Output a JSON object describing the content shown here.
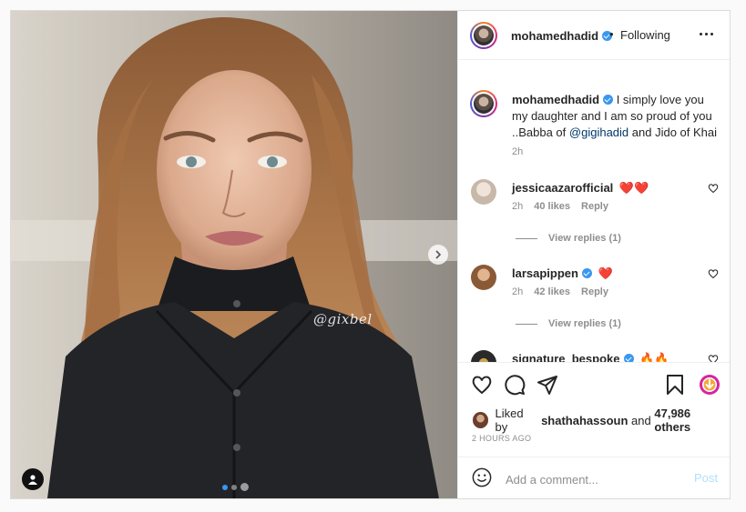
{
  "post": {
    "author": {
      "username": "mohamedhadid",
      "verified": true,
      "follow_separator": "•",
      "follow_status": "Following"
    },
    "media": {
      "watermark": "@gixbel",
      "carousel_dots": 3,
      "active_dot": 0
    },
    "caption": {
      "username": "mohamedhadid",
      "text_before": "I simply love you my daughter and I am so proud of you ..Babba of",
      "mention": "@gigihadid",
      "text_after": "and Jido of Khai",
      "time": "2h"
    },
    "comments": [
      {
        "username": "jessicaazarofficial",
        "text": "❤️❤️",
        "time": "2h",
        "likes": "40 likes",
        "reply_label": "Reply",
        "view_replies": "View replies (1)"
      },
      {
        "username": "larsapippen",
        "verified": true,
        "text": "❤️",
        "time": "2h",
        "likes": "42 likes",
        "reply_label": "Reply",
        "view_replies": "View replies (1)"
      },
      {
        "username": "signature_bespoke",
        "verified": true,
        "text": "🔥🔥"
      }
    ],
    "likes": {
      "prefix": "Liked by",
      "liker": "shathahassoun",
      "joiner": "and",
      "others": "47,986 others"
    },
    "timestamp": "2 HOURS AGO",
    "add_comment": {
      "placeholder": "Add a comment...",
      "post_label": "Post"
    }
  },
  "colors": {
    "verified_blue": "#3897f0",
    "link_blue": "#00376b",
    "post_button_disabled": "#b2dffc",
    "heart_red": "#ed4956",
    "border": "#dbdbdb"
  },
  "icons": {
    "like": "heart-outline-icon",
    "comment": "speech-bubble-icon",
    "share": "paper-plane-icon",
    "save": "bookmark-icon",
    "download": "download-icon",
    "emoji": "smiley-icon",
    "more": "ellipsis-icon",
    "next": "chevron-right-icon",
    "tags": "user-icon"
  }
}
